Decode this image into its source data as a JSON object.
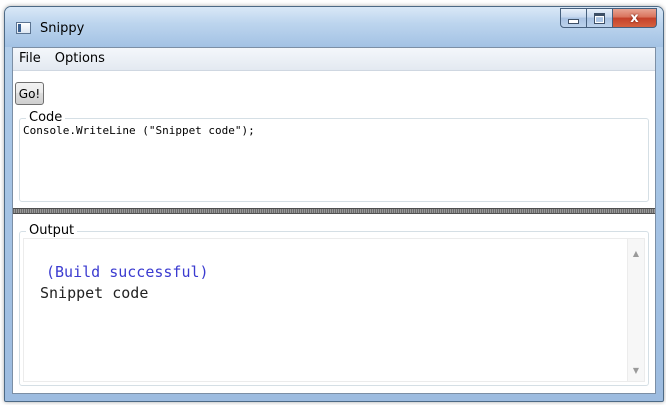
{
  "window": {
    "title": "Snippy",
    "buttons": {
      "minimize": "minimize",
      "maximize": "maximize",
      "close": "x"
    }
  },
  "menu": {
    "items": [
      "File",
      "Options"
    ]
  },
  "toolbar": {
    "go_label": "Go!"
  },
  "code": {
    "label": "Code",
    "text": "Console.WriteLine (\"Snippet code\");"
  },
  "output": {
    "label": "Output",
    "lines": [
      "(Build successful)",
      "Snippet code"
    ],
    "colors": {
      "status": "#3b3bd0",
      "normal": "#222222"
    }
  },
  "icons": {
    "app": "window-icon",
    "scroll_up": "scroll-up-arrow-icon",
    "scroll_down": "scroll-down-arrow-icon"
  }
}
